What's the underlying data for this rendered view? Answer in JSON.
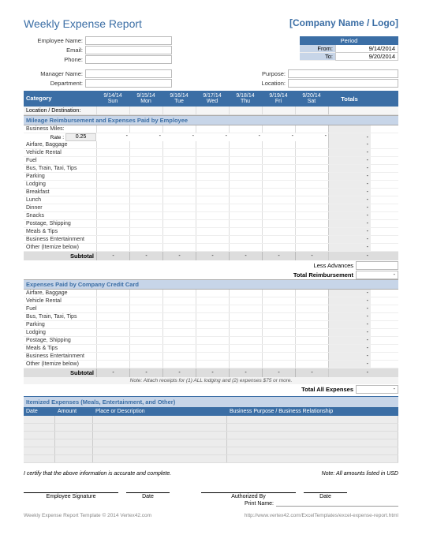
{
  "title": "Weekly Expense Report",
  "company_placeholder": "[Company Name / Logo]",
  "info": {
    "employee_name_label": "Employee Name:",
    "email_label": "Email:",
    "phone_label": "Phone:",
    "manager_label": "Manager Name:",
    "department_label": "Department:",
    "purpose_label": "Purpose:",
    "location_label": "Location:"
  },
  "period": {
    "header": "Period",
    "from_label": "From:",
    "to_label": "To:",
    "from_val": "9/14/2014",
    "to_val": "9/20/2014"
  },
  "columns": {
    "category": "Category",
    "totals": "Totals",
    "days": [
      {
        "date": "9/14/14",
        "day": "Sun"
      },
      {
        "date": "9/15/14",
        "day": "Mon"
      },
      {
        "date": "9/16/14",
        "day": "Tue"
      },
      {
        "date": "9/17/14",
        "day": "Wed"
      },
      {
        "date": "9/18/14",
        "day": "Thu"
      },
      {
        "date": "9/19/14",
        "day": "Fri"
      },
      {
        "date": "9/20/14",
        "day": "Sat"
      }
    ]
  },
  "location_row": "Location / Destination:",
  "section1": {
    "title": "Mileage Reimbursement and Expenses Paid by Employee",
    "business_miles": "Business Miles:",
    "rate_label": "Rate :",
    "rate_val": "0.25",
    "rows": [
      "Airfare, Baggage",
      "Vehicle Rental",
      "Fuel",
      "Bus, Train, Taxi, Tips",
      "Parking",
      "Lodging",
      "Breakfast",
      "Lunch",
      "Dinner",
      "Snacks",
      "Postage, Shipping",
      "Meals & Tips",
      "Business Entertainment",
      "Other (Itemize below)"
    ],
    "subtotal": "Subtotal",
    "less_advances": "Less Advances",
    "total_reimb": "Total Reimbursement"
  },
  "section2": {
    "title": "Expenses Paid by Company Credit Card",
    "rows": [
      "Airfare, Baggage",
      "Vehicle Rental",
      "Fuel",
      "Bus, Train, Taxi, Tips",
      "Parking",
      "Lodging",
      "Postage, Shipping",
      "Meals & Tips",
      "Business Entertainment",
      "Other (Itemize below)"
    ],
    "subtotal": "Subtotal",
    "note": "Note: Attach receipts for (1) ALL lodging and (2) expenses $75 or more.",
    "total_all": "Total All Expenses"
  },
  "itemized": {
    "title": "Itemized Expenses (Meals, Entertainment, and Other)",
    "cols": {
      "date": "Date",
      "amount": "Amount",
      "place": "Place or Description",
      "purpose": "Business Purpose / Business Relationship"
    },
    "row_count": 6
  },
  "certify": "I certify that the above information is accurate and complete.",
  "currency_note": "Note: All amounts listed in USD",
  "sig": {
    "employee": "Employee Signature",
    "date": "Date",
    "authorized": "Authorized By",
    "print": "Print Name:"
  },
  "footer": {
    "left": "Weekly Expense Report Template © 2014 Vertex42.com",
    "right": "http://www.vertex42.com/ExcelTemplates/excel-expense-report.html"
  },
  "dash": "-"
}
